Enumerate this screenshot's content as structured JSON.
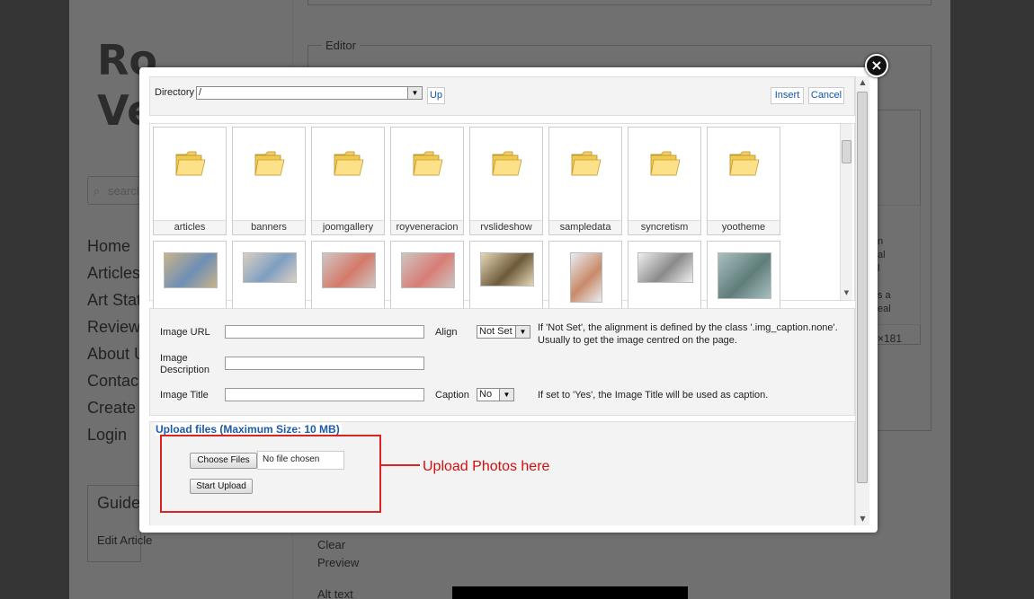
{
  "background": {
    "logo_line1": "Ro",
    "logo_line2": "Ve",
    "search_placeholder": "search",
    "editor_legend": "Editor",
    "nav": [
      "Home",
      "Articles",
      "Art Stat",
      "Reviews",
      "About U",
      "Contac",
      "Create",
      "Login"
    ],
    "guide_title": "Guide",
    "edit_article": "Edit Article",
    "clear": "Clear",
    "preview": "Preview",
    "alt_text": "Alt text",
    "right_fragments": [
      "n",
      "al",
      "l",
      "s a",
      "eal"
    ],
    "size_fragment": "×181"
  },
  "modal": {
    "close_label": "×",
    "toolbar": {
      "directory_label": "Directory",
      "directory_value": "/",
      "up_label": "Up",
      "insert_label": "Insert",
      "cancel_label": "Cancel"
    },
    "folders": [
      "articles",
      "banners",
      "joomgallery",
      "royveneracion",
      "rvslideshow",
      "sampledata",
      "syncretism",
      "yootheme"
    ],
    "form": {
      "image_url_label": "Image URL",
      "image_url_value": "",
      "align_label": "Align",
      "align_value": "Not Set",
      "align_help": "If 'Not Set', the alignment is defined by the class '.img_caption.none'. Usually to get the image centred on the page.",
      "image_description_label_1": "Image",
      "image_description_label_2": "Description",
      "image_description_value": "",
      "image_title_label": "Image Title",
      "image_title_value": "",
      "caption_label": "Caption",
      "caption_value": "No",
      "caption_help": "If set to 'Yes', the Image Title will be used as caption."
    },
    "upload": {
      "legend": "Upload files (Maximum Size: 10 MB)",
      "choose_files_label": "Choose Files",
      "no_file_text": "No file chosen",
      "start_upload_label": "Start Upload"
    }
  },
  "annotation": {
    "text": "Upload Photos here",
    "color": "#d01010"
  }
}
